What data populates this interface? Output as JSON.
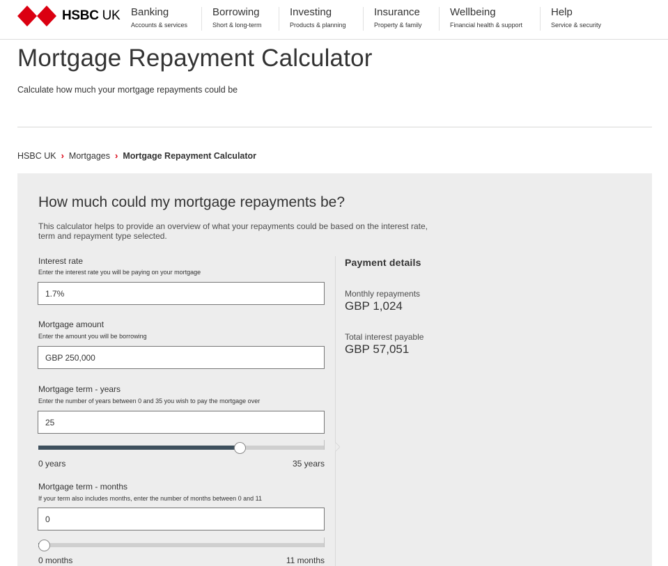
{
  "header": {
    "logo_text_bold": "HSBC",
    "logo_text_light": "UK",
    "brand_color": "#db0011",
    "nav": [
      {
        "title": "Banking",
        "sub": "Accounts & services"
      },
      {
        "title": "Borrowing",
        "sub": "Short & long-term"
      },
      {
        "title": "Investing",
        "sub": "Products & planning"
      },
      {
        "title": "Insurance",
        "sub": "Property & family"
      },
      {
        "title": "Wellbeing",
        "sub": "Financial health & support"
      },
      {
        "title": "Help",
        "sub": "Service & security"
      }
    ]
  },
  "page": {
    "title": "Mortgage Repayment Calculator",
    "subtitle": "Calculate how much your mortgage repayments could be"
  },
  "breadcrumb": {
    "items": [
      "HSBC UK",
      "Mortgages",
      "Mortgage Repayment Calculator"
    ],
    "separator": "›"
  },
  "calculator": {
    "title": "How much could my mortgage repayments be?",
    "intro": "This calculator helps to provide an overview of what your repayments could be based on the interest rate, term and repayment type selected.",
    "interest_rate": {
      "label": "Interest rate",
      "hint": "Enter the interest rate you will be paying on your mortgage",
      "value": "1.7%"
    },
    "mortgage_amount": {
      "label": "Mortgage amount",
      "hint": "Enter the amount you will be borrowing",
      "value": "GBP 250,000"
    },
    "term_years": {
      "label": "Mortgage term - years",
      "hint": "Enter the number of years between 0 and 35 you wish to pay the mortgage over",
      "value": "25",
      "slider_value": 25,
      "slider_min": 0,
      "slider_max": 35,
      "min_label": "0 years",
      "max_label": "35 years"
    },
    "term_months": {
      "label": "Mortgage term - months",
      "hint": "If your term also includes months, enter the number of months between 0 and 11",
      "value": "0",
      "slider_value": 0,
      "slider_min": 0,
      "slider_max": 11,
      "min_label": "0 months",
      "max_label": "11 months"
    },
    "payment": {
      "title": "Payment details",
      "monthly_label": "Monthly repayments",
      "monthly_value": "GBP 1,024",
      "interest_label": "Total interest payable",
      "interest_value": "GBP 57,051"
    },
    "slider_fill_color": "#3e505d"
  }
}
